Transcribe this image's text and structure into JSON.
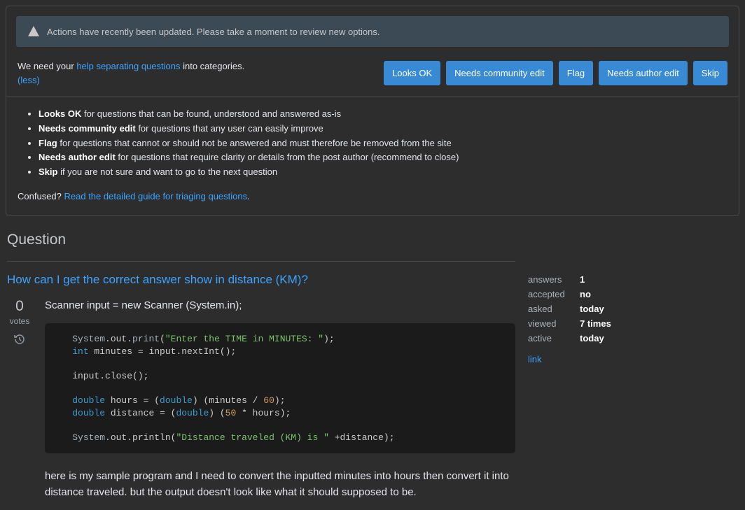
{
  "notice": "Actions have recently been updated. Please take a moment to review new options.",
  "help": {
    "prefix": "We need your ",
    "link": "help separating questions",
    "suffix": " into categories.",
    "less": "(less)"
  },
  "buttons": {
    "ok": "Looks OK",
    "community": "Needs community edit",
    "flag": "Flag",
    "author": "Needs author edit",
    "skip": "Skip"
  },
  "guide": {
    "items": [
      {
        "b": "Looks OK",
        "rest": " for questions that can be found, understood and answered as-is"
      },
      {
        "b": "Needs community edit",
        "rest": " for questions that any user can easily improve"
      },
      {
        "b": "Flag",
        "rest": " for questions that cannot or should not be answered and must therefore be removed from the site"
      },
      {
        "b": "Needs author edit",
        "rest": " for questions that require clarity or details from the post author (recommend to close)"
      },
      {
        "b": "Skip",
        "rest": " if you are not sure and want to go to the next question"
      }
    ],
    "confused_prefix": "Confused? ",
    "confused_link": "Read the detailed guide for triaging questions",
    "confused_suffix": "."
  },
  "section_header": "Question",
  "question": {
    "title": "How can I get the correct answer show in distance (KM)?",
    "score": "0",
    "votes_label": "votes",
    "intro": "Scanner input = new Scanner (System.in);",
    "outro": "here is my sample program and I need to convert the inputted minutes into hours then convert it into distance traveled. but the output doesn't look like what it should supposed to be."
  },
  "stats": {
    "answers_l": "answers",
    "answers_v": "1",
    "accepted_l": "accepted",
    "accepted_v": "no",
    "asked_l": "asked",
    "asked_v": "today",
    "viewed_l": "viewed",
    "viewed_v": "7 times",
    "active_l": "active",
    "active_v": "today",
    "link": "link"
  }
}
